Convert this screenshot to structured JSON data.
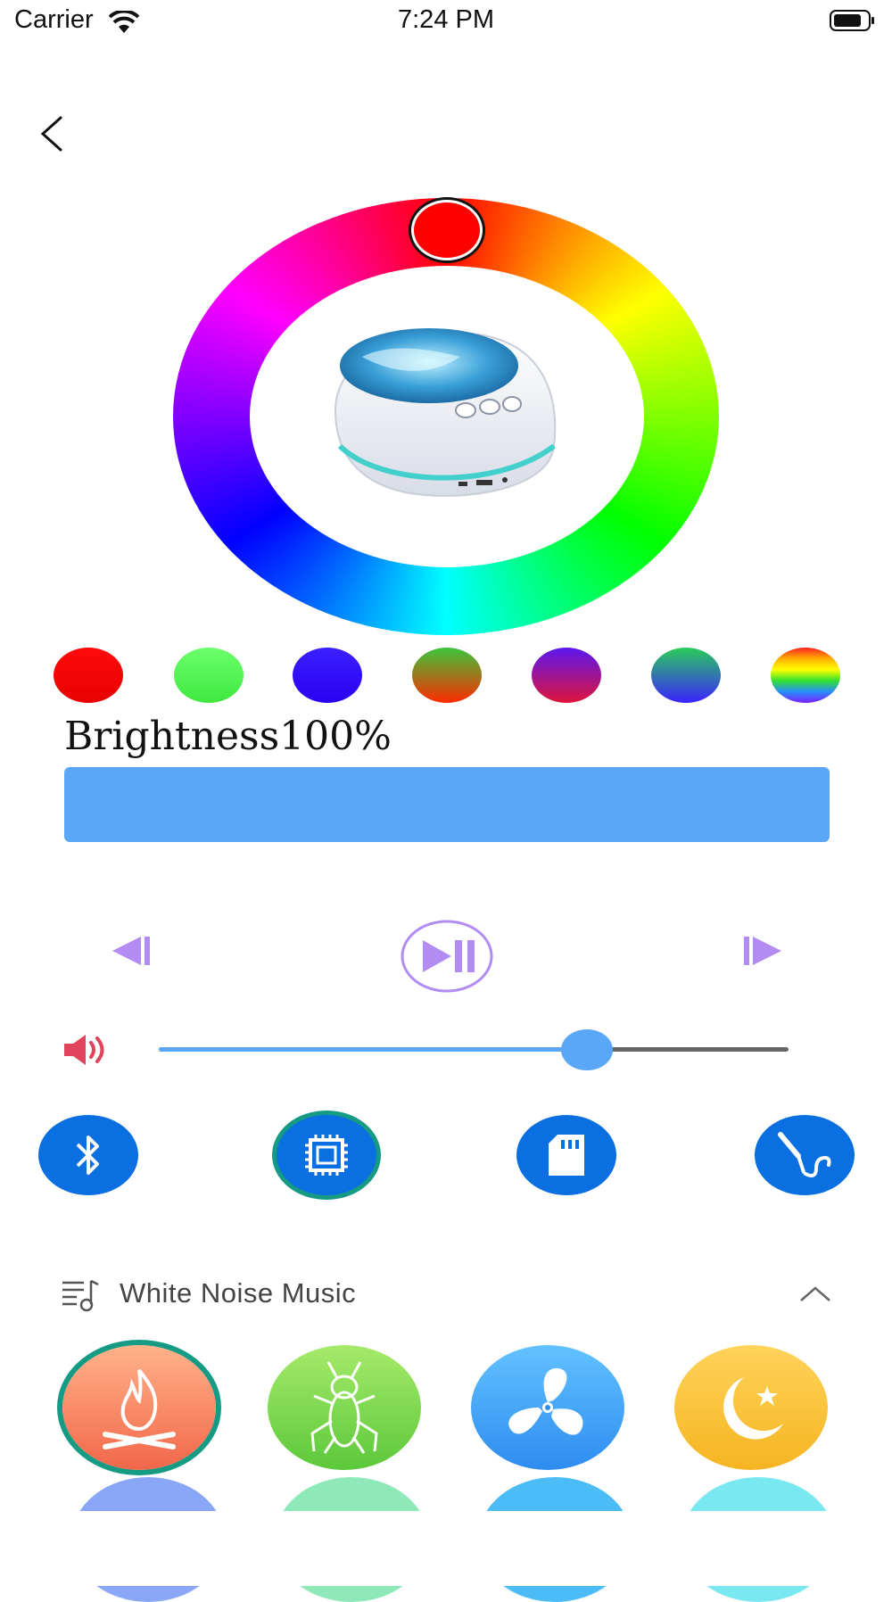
{
  "status_bar": {
    "carrier": "Carrier",
    "time": "7:24 PM"
  },
  "navigation": {
    "back_icon": "chevron-left-icon"
  },
  "color_wheel": {
    "selected_color": "#ff0000"
  },
  "presets": [
    {
      "name": "red",
      "colors": [
        "#ff0a0a",
        "#e80000"
      ]
    },
    {
      "name": "green",
      "colors": [
        "#6cff6c",
        "#3ee83e"
      ]
    },
    {
      "name": "blue",
      "colors": [
        "#3b20ff",
        "#2a00f0"
      ]
    },
    {
      "name": "green-red",
      "colors": [
        "#3cc63c",
        "#ff2a00"
      ]
    },
    {
      "name": "purple-red",
      "colors": [
        "#5a16f0",
        "#e0143a"
      ]
    },
    {
      "name": "green-blue",
      "colors": [
        "#2acc5a",
        "#3a22ff"
      ]
    },
    {
      "name": "rainbow",
      "colors": [
        "#ff2020",
        "#ffb000",
        "#ffff00",
        "#30e030",
        "#2a8cff",
        "#7a20ff"
      ]
    }
  ],
  "brightness": {
    "label": "Brightness100%",
    "value_percent": 100,
    "color": "#5aa6f7"
  },
  "transport": {
    "prev_icon": "previous-icon",
    "play_icon": "play-pause-icon",
    "next_icon": "next-icon",
    "accent": "#b28cf2"
  },
  "volume": {
    "icon": "speaker-icon",
    "value_percent": 68,
    "icon_color": "#e0445c"
  },
  "modes": [
    {
      "name": "bluetooth",
      "icon": "bluetooth-icon",
      "selected": false
    },
    {
      "name": "chip",
      "icon": "chip-icon",
      "selected": true
    },
    {
      "name": "sd-card",
      "icon": "sd-card-icon",
      "selected": false
    },
    {
      "name": "audio-cable",
      "icon": "audio-cable-icon",
      "selected": false
    }
  ],
  "white_noise": {
    "title": "White Noise Music",
    "icon": "music-list-icon",
    "chevron": "chevron-up-icon",
    "sounds": [
      {
        "name": "campfire",
        "icon": "campfire-icon",
        "colors": [
          "#ffb28a",
          "#f2674a"
        ],
        "selected": true
      },
      {
        "name": "cricket",
        "icon": "cricket-icon",
        "colors": [
          "#a6ea6a",
          "#5cc83a"
        ],
        "selected": false
      },
      {
        "name": "fan",
        "icon": "fan-icon",
        "colors": [
          "#62c2ff",
          "#2e8cf0"
        ],
        "selected": false
      },
      {
        "name": "night",
        "icon": "moon-star-icon",
        "colors": [
          "#ffd35a",
          "#f6b422"
        ],
        "selected": false
      }
    ],
    "row2_colors": [
      "#8aa6f6",
      "#8ee8b8",
      "#4cbcf6",
      "#7ae8f0"
    ]
  }
}
